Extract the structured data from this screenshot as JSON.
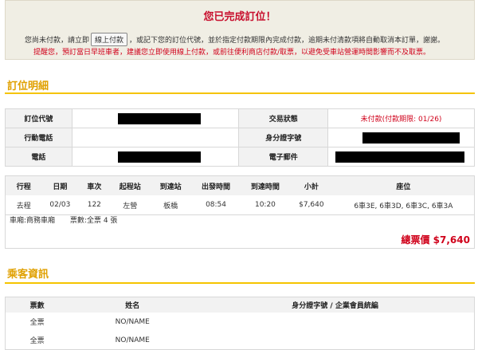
{
  "banner": {
    "title": "您已完成訂位！",
    "line1_before": "您尚未付款，請立即",
    "pay_button": "線上付款",
    "line1_after": "，或記下您的訂位代號，並於指定付款期限內完成付款，逾期未付清款項將自動取消本訂單，謝謝。",
    "line2": "提醒您，預訂當日早班車者，建議您立即使用線上付款，或前往便利商店付款/取票，以避免受車站營運時間影響而不及取票。"
  },
  "booking": {
    "section_title": "訂位明細",
    "labels": {
      "code": "訂位代號",
      "mobile": "行動電話",
      "phone": "電話",
      "status": "交易狀態",
      "id": "身分證字號",
      "email": "電子郵件"
    },
    "status_value": "未付款(付款期限: 01/26)"
  },
  "trip": {
    "headers": [
      "行程",
      "日期",
      "車次",
      "起程站",
      "到達站",
      "出發時間",
      "到達時間",
      "小計",
      "座位"
    ],
    "row": [
      "去程",
      "02/03",
      "122",
      "左營",
      "板橋",
      "08:54",
      "10:20",
      "$7,640",
      "6車3E, 6車3D, 6車3C, 6車3A"
    ],
    "car_class": "車廂:商務車廂",
    "ticket_count": "票數:全票 4 張",
    "total": "總票價 $7,640"
  },
  "passengers": {
    "section_title": "乘客資訊",
    "headers": [
      "票數",
      "姓名",
      "身分證字號 / 企業會員統編"
    ],
    "rows": [
      {
        "ticket": "全票",
        "name": "NO/NAME"
      },
      {
        "ticket": "全票",
        "name": "NO/NAME"
      }
    ]
  },
  "colors": {
    "accent_red": "#c8102e",
    "section_gold": "#e0a000",
    "rule_yellow": "#f5c400",
    "banner_bg": "#f0eee4"
  }
}
